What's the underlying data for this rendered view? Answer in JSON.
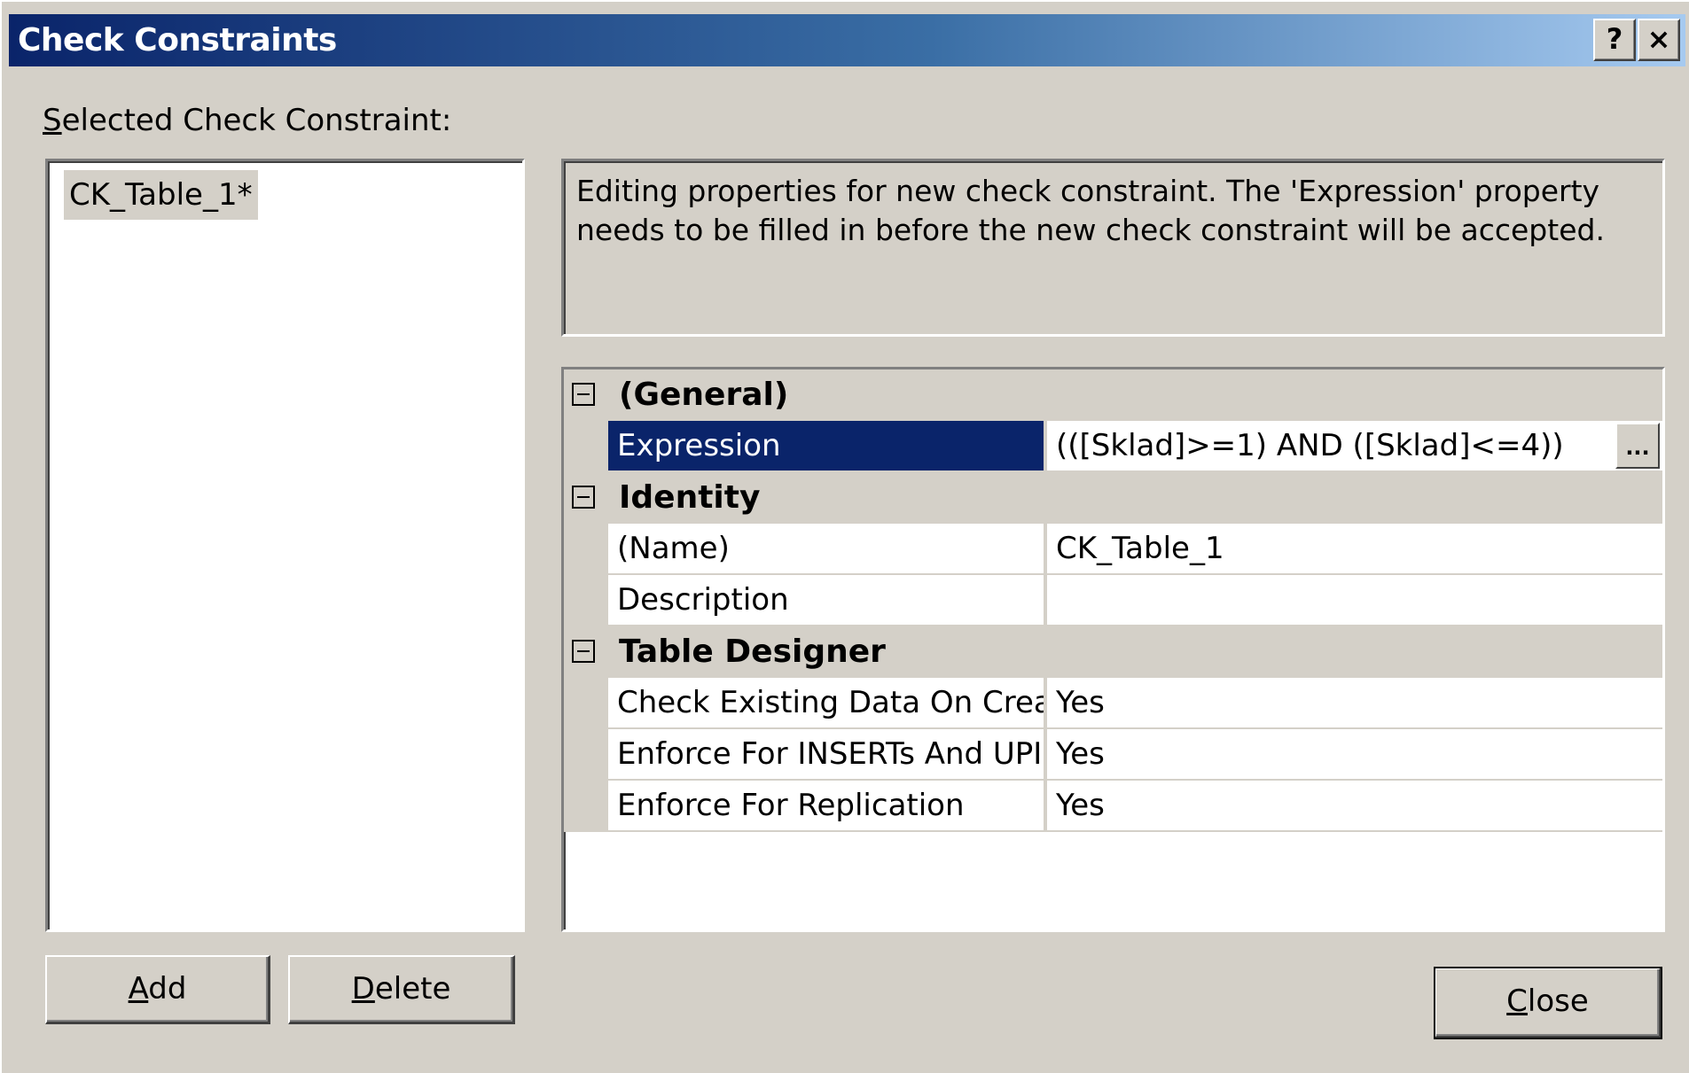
{
  "dialog": {
    "title": "Check Constraints",
    "help_button": "?",
    "close_button": "×"
  },
  "selected_label": {
    "accel": "S",
    "rest": "elected Check Constraint:"
  },
  "constraints_list": [
    "CK_Table_1*"
  ],
  "info_text": "Editing properties for new check constraint.  The 'Expression' property needs to be filled in before the new check constraint will be accepted.",
  "properties": {
    "general": {
      "label": "(General)",
      "rows": [
        {
          "name": "Expression",
          "value": "(([Sklad]>=1) AND ([Sklad]<=4))",
          "ellipsis": "..."
        }
      ]
    },
    "identity": {
      "label": "Identity",
      "rows": [
        {
          "name": "(Name)",
          "value": "CK_Table_1"
        },
        {
          "name": "Description",
          "value": ""
        }
      ]
    },
    "table_designer": {
      "label": "Table Designer",
      "rows": [
        {
          "name": "Check Existing Data On Crea",
          "value": "Yes"
        },
        {
          "name": "Enforce For INSERTs And UPI",
          "value": "Yes"
        },
        {
          "name": "Enforce For Replication",
          "value": "Yes"
        }
      ]
    }
  },
  "buttons": {
    "add": {
      "accel": "A",
      "rest": "dd"
    },
    "delete": {
      "accel": "D",
      "rest": "elete"
    },
    "close": {
      "accel": "C",
      "rest": "lose"
    }
  },
  "colors": {
    "title_gradient_start": "#0a246a",
    "title_gradient_end": "#a6caf0",
    "selection": "#0a246a",
    "face": "#d4d0c8"
  }
}
